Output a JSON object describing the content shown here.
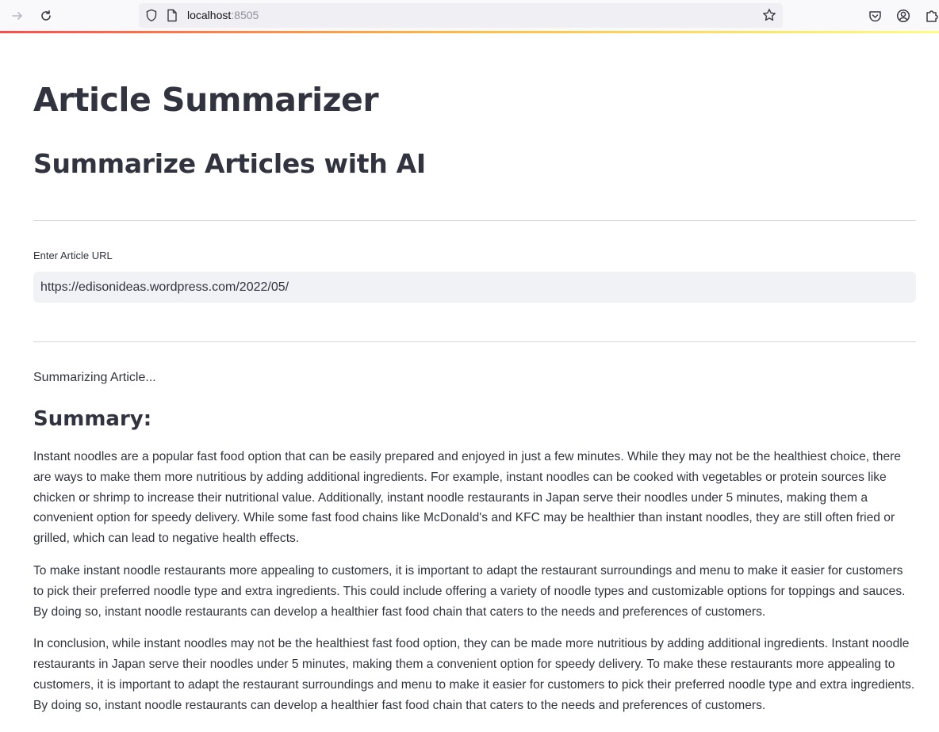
{
  "browser": {
    "url_host": "localhost",
    "url_port": ":8505"
  },
  "app": {
    "title": "Article Summarizer",
    "subtitle": "Summarize Articles with AI",
    "url_label": "Enter Article URL",
    "url_value": "https://edisonideas.wordpress.com/2022/05/",
    "status": "Summarizing Article...",
    "summary_heading": "Summary:",
    "summary_paragraphs": [
      "Instant noodles are a popular fast food option that can be easily prepared and enjoyed in just a few minutes. While they may not be the healthiest choice, there are ways to make them more nutritious by adding additional ingredients. For example, instant noodles can be cooked with vegetables or protein sources like chicken or shrimp to increase their nutritional value. Additionally, instant noodle restaurants in Japan serve their noodles under 5 minutes, making them a convenient option for speedy delivery. While some fast food chains like McDonald's and KFC may be healthier than instant noodles, they are still often fried or grilled, which can lead to negative health effects.",
      "To make instant noodle restaurants more appealing to customers, it is important to adapt the restaurant surroundings and menu to make it easier for customers to pick their preferred noodle type and extra ingredients. This could include offering a variety of noodle types and customizable options for toppings and sauces. By doing so, instant noodle restaurants can develop a healthier fast food chain that caters to the needs and preferences of customers.",
      "In conclusion, while instant noodles may not be the healthiest fast food option, they can be made more nutritious by adding additional ingredients. Instant noodle restaurants in Japan serve their noodles under 5 minutes, making them a convenient option for speedy delivery. To make these restaurants more appealing to customers, it is important to adapt the restaurant surroundings and menu to make it easier for customers to pick their preferred noodle type and extra ingredients. By doing so, instant noodle restaurants can develop a healthier fast food chain that caters to the needs and preferences of customers."
    ]
  },
  "icons": {
    "forward": "forward-arrow-icon",
    "reload": "reload-icon",
    "shield": "shield-icon",
    "page": "page-icon",
    "bookmark": "star-icon",
    "pocket": "pocket-icon",
    "account": "account-icon",
    "extensions": "extensions-icon"
  },
  "colors": {
    "accent_start": "#ff4b4b",
    "accent_mid": "#ffbd45",
    "accent_end": "#fffd80",
    "text": "#31333f",
    "input_bg": "#f0f2f6"
  }
}
